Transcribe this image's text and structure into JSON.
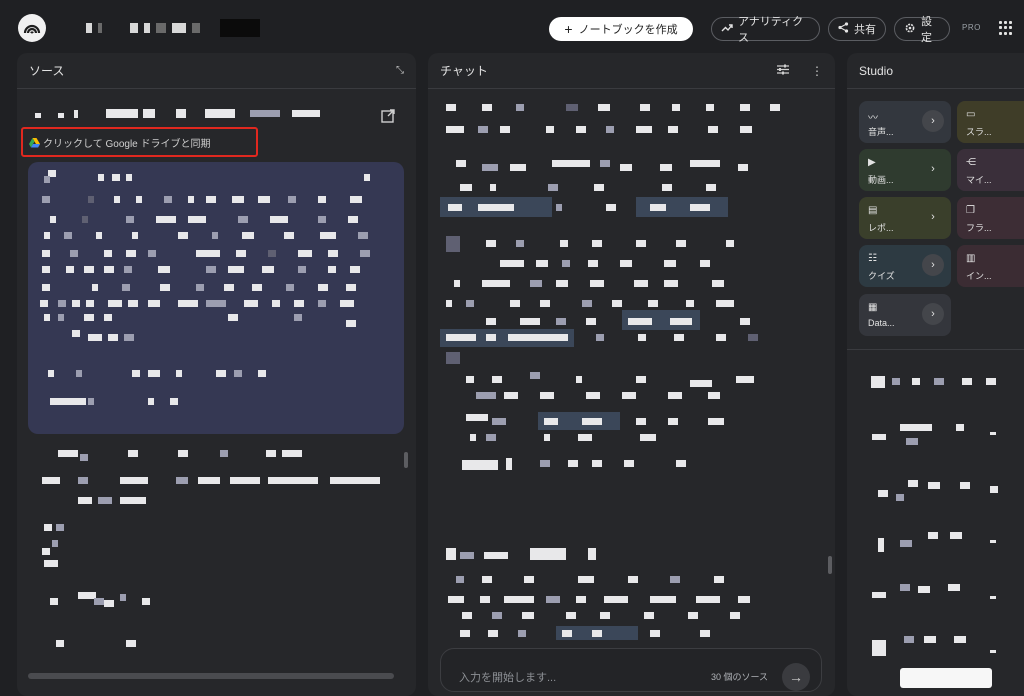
{
  "toolbar": {
    "create_label": "ノートブックを作成",
    "analytics_label": "アナリティクス",
    "share_label": "共有",
    "settings_label": "設定",
    "pro_badge": "PRO"
  },
  "sources": {
    "heading": "ソース",
    "sync_label": "クリックして Google ドライブと同期"
  },
  "chat": {
    "heading": "チャット",
    "input_placeholder": "入力を開始します...",
    "source_count": "30 個のソース"
  },
  "studio": {
    "heading": "Studio",
    "tiles": [
      {
        "label": "音声...",
        "icon": "waveform-icon"
      },
      {
        "label": "スラ...",
        "icon": "slides-icon"
      },
      {
        "label": "動画...",
        "icon": "video-icon"
      },
      {
        "label": "マイ...",
        "icon": "mindmap-icon"
      },
      {
        "label": "レポ...",
        "icon": "report-icon"
      },
      {
        "label": "フラ...",
        "icon": "flashcard-icon"
      },
      {
        "label": "クイズ",
        "icon": "quiz-icon"
      },
      {
        "label": "イン...",
        "icon": "infographic-icon"
      },
      {
        "label": "Data...",
        "icon": "table-icon"
      }
    ]
  },
  "colors": {
    "background": "#1f2023",
    "panel": "#26272a",
    "sync_highlight_border": "#e0281f",
    "source_card": "#353853"
  }
}
